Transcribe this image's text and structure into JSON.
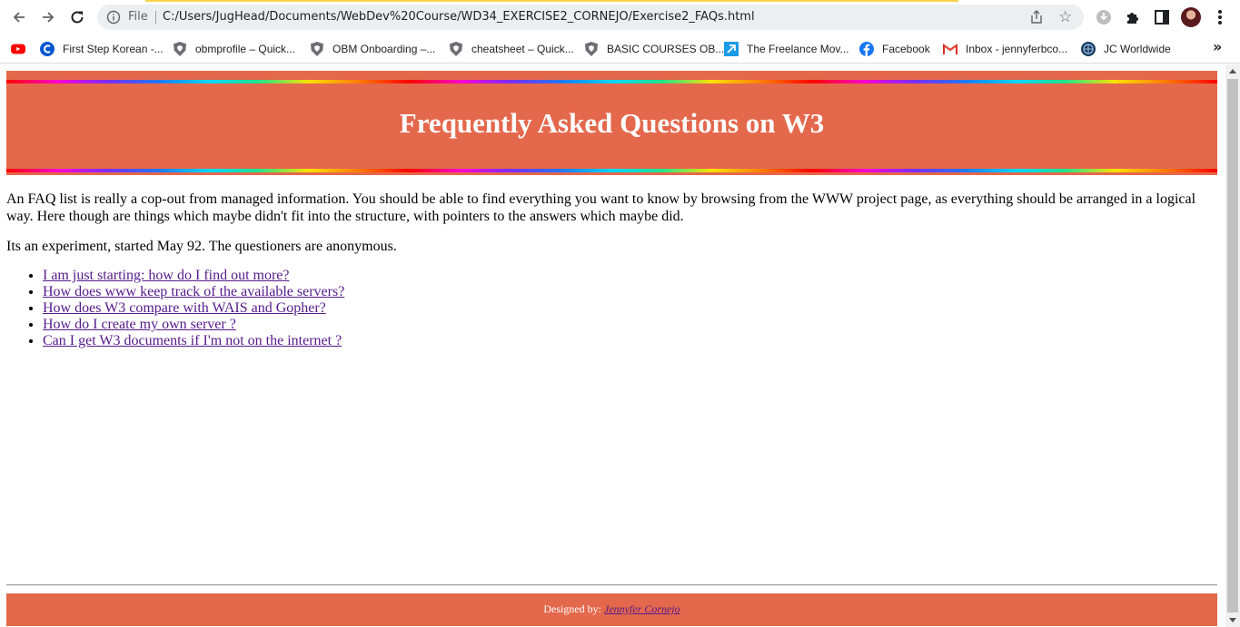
{
  "browser": {
    "address_scheme": "File",
    "url": "C:/Users/JugHead/Documents/WebDev%20Course/WD34_EXERCISE2_CORNEJO/Exercise2_FAQs.html"
  },
  "bookmarks": [
    {
      "label": "",
      "icon": "youtube-icon"
    },
    {
      "label": "First Step Korean -...",
      "icon": "coursera-icon"
    },
    {
      "label": "obmprofile – Quick...",
      "icon": "shield-icon"
    },
    {
      "label": "OBM Onboarding –...",
      "icon": "shield-icon"
    },
    {
      "label": "cheatsheet – Quick...",
      "icon": "shield-icon"
    },
    {
      "label": "BASIC COURSES OB...",
      "icon": "shield-icon"
    },
    {
      "label": "The Freelance Mov...",
      "icon": "freelance-icon"
    },
    {
      "label": "Facebook",
      "icon": "facebook-icon"
    },
    {
      "label": "Inbox - jennyferbco...",
      "icon": "gmail-icon"
    },
    {
      "label": "JC Worldwide",
      "icon": "jc-icon"
    }
  ],
  "page": {
    "title": "Frequently Asked Questions on W3",
    "paragraphs": [
      "An FAQ list is really a cop-out from managed information. You should be able to find everything you want to know by browsing from the WWW project page, as everything should be arranged in a logical way. Here though are things which maybe didn't fit into the structure, with pointers to the answers which maybe did.",
      "Its an experiment, started May 92. The questioners are anonymous."
    ],
    "faq_links": [
      "I am just starting: how do I find out more?",
      "How does www keep track of the available servers?",
      "How does W3 compare with WAIS and Gopher?",
      "How do I create my own server ?",
      "Can I get W3 documents if I'm not on the internet ?"
    ],
    "footer": {
      "prefix": "Designed by: ",
      "author": "Jennyfer Cornejo"
    }
  },
  "colors": {
    "banner": "#e4684c",
    "link": "#551a8b"
  }
}
